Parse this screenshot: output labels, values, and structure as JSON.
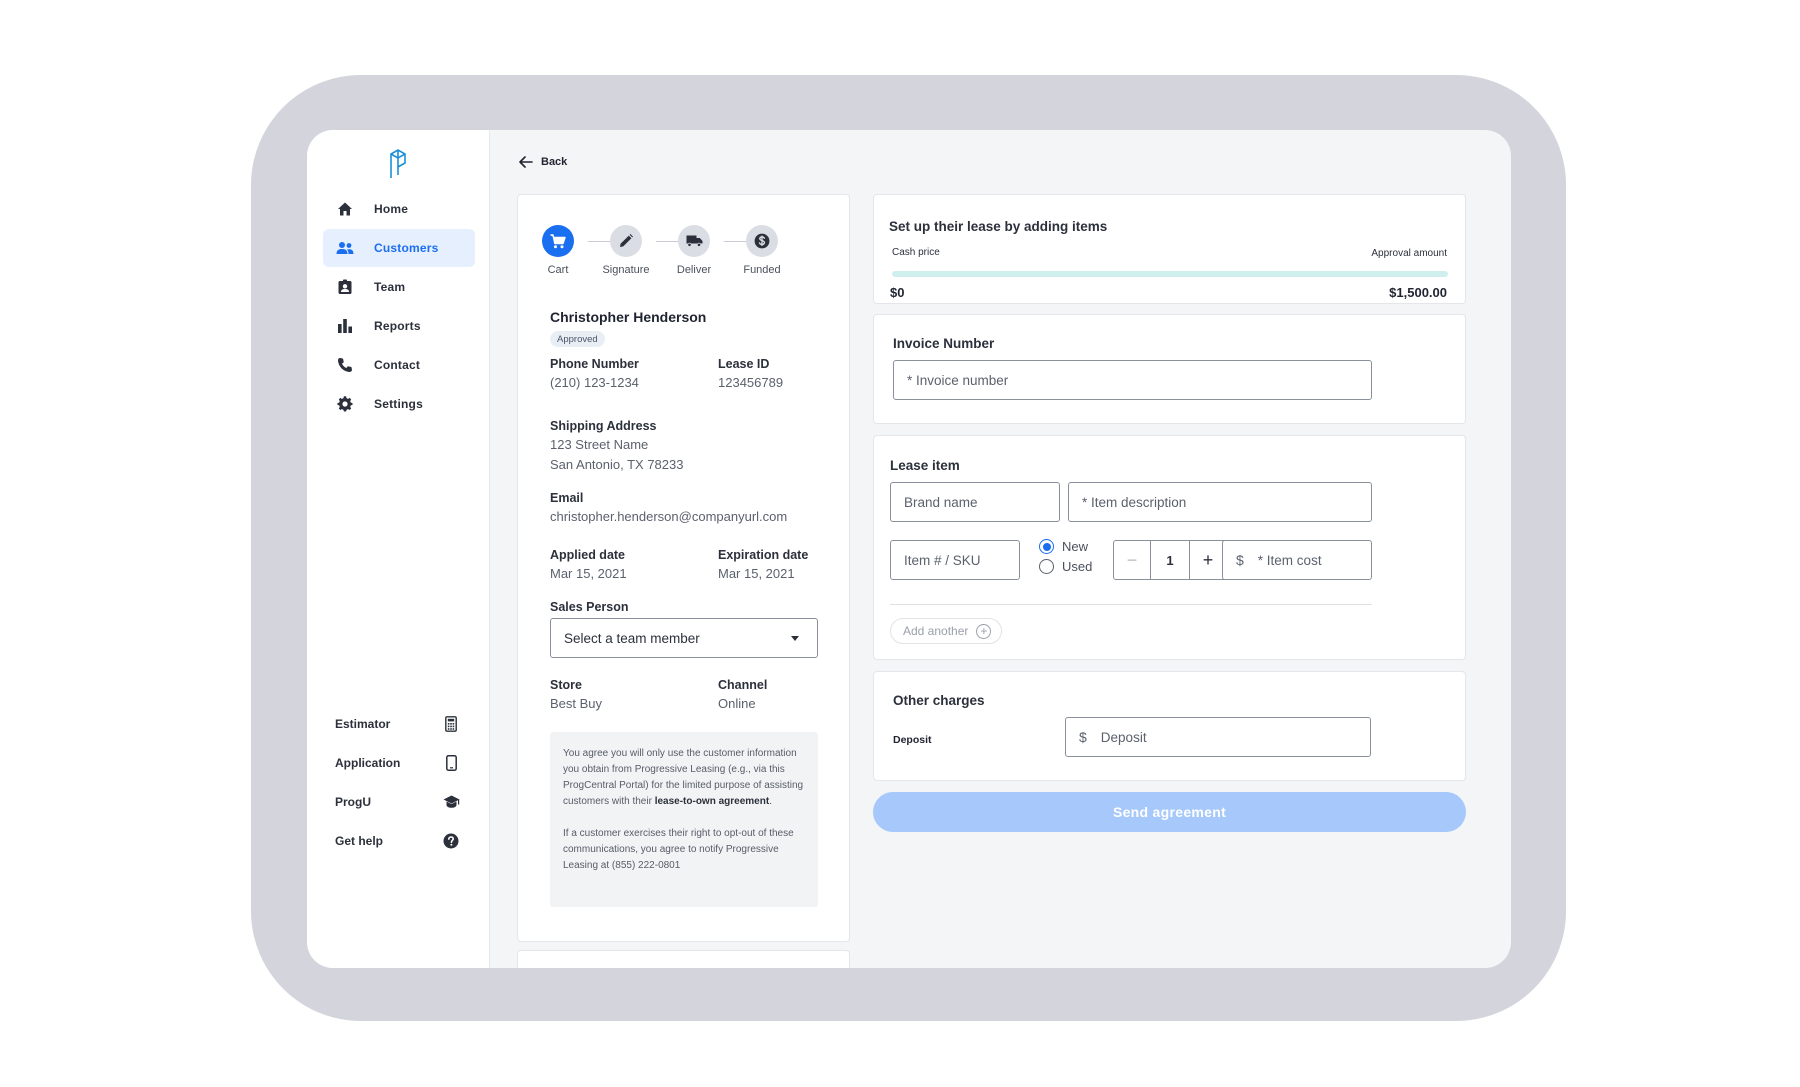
{
  "back_label": "Back",
  "sidebar": {
    "nav": [
      {
        "label": "Home",
        "icon": "home-icon"
      },
      {
        "label": "Customers",
        "icon": "users-icon",
        "active": true
      },
      {
        "label": "Team",
        "icon": "badge-icon"
      },
      {
        "label": "Reports",
        "icon": "bar-chart-icon"
      },
      {
        "label": "Contact",
        "icon": "phone-icon"
      },
      {
        "label": "Settings",
        "icon": "gear-icon"
      }
    ],
    "tools": [
      {
        "label": "Estimator",
        "icon": "calculator-icon"
      },
      {
        "label": "Application",
        "icon": "mobile-icon"
      },
      {
        "label": "ProgU",
        "icon": "graduation-cap-icon"
      },
      {
        "label": "Get help",
        "icon": "help-icon"
      }
    ]
  },
  "steps": [
    {
      "label": "Cart",
      "icon": "cart-icon",
      "active": true
    },
    {
      "label": "Signature",
      "icon": "pencil-icon"
    },
    {
      "label": "Deliver",
      "icon": "truck-icon"
    },
    {
      "label": "Funded",
      "icon": "dollar-icon"
    }
  ],
  "customer": {
    "name": "Christopher Henderson",
    "status": "Approved",
    "phone_label": "Phone Number",
    "phone": "(210) 123-1234",
    "lease_id_label": "Lease ID",
    "lease_id": "123456789",
    "address_label": "Shipping Address",
    "address_line1": "123 Street Name",
    "address_line2": "San Antonio, TX 78233",
    "email_label": "Email",
    "email": "christopher.henderson@companyurl.com",
    "applied_label": "Applied date",
    "applied": "Mar 15, 2021",
    "expiration_label": "Expiration date",
    "expiration": "Mar 15, 2021",
    "sales_label": "Sales Person",
    "sales_placeholder": "Select a team member",
    "store_label": "Store",
    "store": "Best Buy",
    "channel_label": "Channel",
    "channel": "Online"
  },
  "disclaimer": {
    "p1_before": "You agree you will only use the customer information you obtain from Progressive Leasing (e.g., via this ProgCentral Portal) for the limited purpose of assisting customers with their ",
    "p1_bold": "lease-to-own agreement",
    "p1_after": ".",
    "p2": "If a customer exercises their right to opt-out of these communications, you agree to notify Progressive Leasing at (855) 222-0801"
  },
  "lease_setup": {
    "title": "Set up their lease by adding items",
    "cash_label": "Cash price",
    "approval_label": "Approval amount",
    "cash_value": "$0",
    "approval_value": "$1,500.00"
  },
  "invoice": {
    "title": "Invoice Number",
    "placeholder": "* Invoice number"
  },
  "lease_item": {
    "title": "Lease item",
    "brand_placeholder": "Brand name",
    "desc_placeholder": "* Item description",
    "sku_placeholder": "Item # / SKU",
    "condition_new": "New",
    "condition_used": "Used",
    "quantity": "1",
    "cost_placeholder": "* Item cost",
    "add_another": "Add another"
  },
  "other_charges": {
    "title": "Other charges",
    "deposit_label": "Deposit",
    "deposit_placeholder": "Deposit"
  },
  "send_label": "Send agreement",
  "colors": {
    "accent": "#1a6ef0",
    "send_disabled": "#a6c8fb",
    "progress_track": "#cfeeee"
  }
}
